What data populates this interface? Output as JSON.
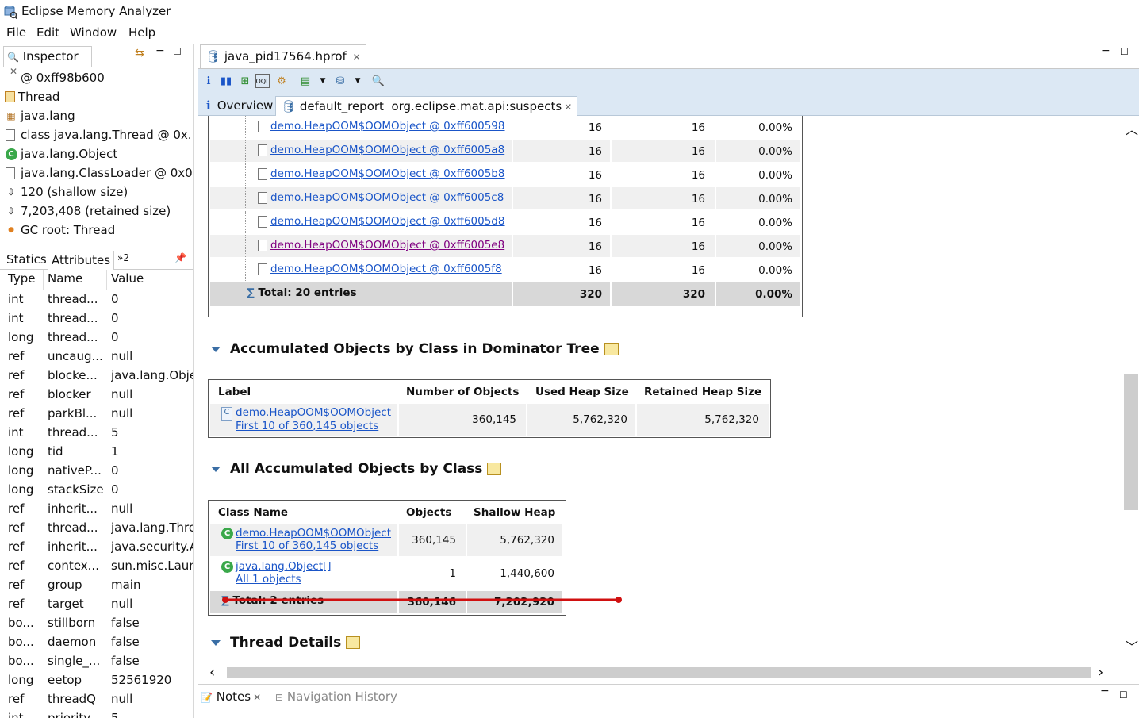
{
  "window": {
    "title": "Eclipse Memory Analyzer"
  },
  "menu": [
    "File",
    "Edit",
    "Window",
    "Help"
  ],
  "inspector": {
    "tab_label": "Inspector",
    "rows": [
      {
        "icon": "at-icon",
        "text": "@ 0xff98b600"
      },
      {
        "icon": "class-icon",
        "text": "Thread"
      },
      {
        "icon": "package-icon",
        "text": "java.lang"
      },
      {
        "icon": "class-file-icon",
        "text": "class java.lang.Thread @ 0x..."
      },
      {
        "icon": "class-green-icon",
        "text": "java.lang.Object"
      },
      {
        "icon": "class-file-icon",
        "text": "java.lang.ClassLoader @ 0x0"
      },
      {
        "icon": "size-icon",
        "text": "120 (shallow size)"
      },
      {
        "icon": "size-icon",
        "text": "7,203,408 (retained size)"
      },
      {
        "icon": "gc-root-icon",
        "text": "GC root: Thread"
      }
    ],
    "subtabs": [
      "Statics",
      "Attributes",
      "»2"
    ],
    "columns": [
      "Type",
      "Name",
      "Value"
    ],
    "attributes": [
      [
        "int",
        "thread...",
        "0"
      ],
      [
        "int",
        "thread...",
        "0"
      ],
      [
        "long",
        "thread...",
        "0"
      ],
      [
        "ref",
        "uncaug...",
        "null"
      ],
      [
        "ref",
        "blocke...",
        "java.lang.Obje"
      ],
      [
        "ref",
        "blocker",
        "null"
      ],
      [
        "ref",
        "parkBl...",
        "null"
      ],
      [
        "int",
        "thread...",
        "5"
      ],
      [
        "long",
        "tid",
        "1"
      ],
      [
        "long",
        "nativeP...",
        "0"
      ],
      [
        "long",
        "stackSize",
        "0"
      ],
      [
        "ref",
        "inherit...",
        "null"
      ],
      [
        "ref",
        "thread...",
        "java.lang.Thre"
      ],
      [
        "ref",
        "inherit...",
        "java.security.A"
      ],
      [
        "ref",
        "contex...",
        "sun.misc.Laun"
      ],
      [
        "ref",
        "group",
        "main"
      ],
      [
        "ref",
        "target",
        "null"
      ],
      [
        "bo...",
        "stillborn",
        "false"
      ],
      [
        "bo...",
        "daemon",
        "false"
      ],
      [
        "bo...",
        "single_...",
        "false"
      ],
      [
        "long",
        "eetop",
        "52561920"
      ],
      [
        "ref",
        "threadQ",
        "null"
      ],
      [
        "int",
        "priority",
        "5"
      ]
    ]
  },
  "editor": {
    "tab_label": "java_pid17564.hprof",
    "inner_tabs": [
      "Overview",
      "default_report  org.eclipse.mat.api:suspects"
    ],
    "top_table": {
      "rows": [
        [
          "demo.HeapOOM$OOMObject @ 0xff600598",
          "16",
          "16",
          "0.00%"
        ],
        [
          "demo.HeapOOM$OOMObject @ 0xff6005a8",
          "16",
          "16",
          "0.00%"
        ],
        [
          "demo.HeapOOM$OOMObject @ 0xff6005b8",
          "16",
          "16",
          "0.00%"
        ],
        [
          "demo.HeapOOM$OOMObject @ 0xff6005c8",
          "16",
          "16",
          "0.00%"
        ],
        [
          "demo.HeapOOM$OOMObject @ 0xff6005d8",
          "16",
          "16",
          "0.00%"
        ],
        [
          "demo.HeapOOM$OOMObject @ 0xff6005e8",
          "16",
          "16",
          "0.00%"
        ],
        [
          "demo.HeapOOM$OOMObject @ 0xff6005f8",
          "16",
          "16",
          "0.00%"
        ]
      ],
      "total": [
        "Total: 20 entries",
        "320",
        "320",
        "0.00%"
      ]
    },
    "section1": {
      "title": "Accumulated Objects by Class in Dominator Tree",
      "columns": [
        "Label",
        "Number of Objects",
        "Used Heap Size",
        "Retained Heap Size"
      ],
      "row": {
        "link1": "demo.HeapOOM$OOMObject",
        "link2": "First 10 of 360,145 objects",
        "objects": "360,145",
        "used": "5,762,320",
        "retained": "5,762,320"
      }
    },
    "section2": {
      "title": "All Accumulated Objects by Class",
      "columns": [
        "Class Name",
        "Objects",
        "Shallow Heap"
      ],
      "rows": [
        {
          "link1": "demo.HeapOOM$OOMObject",
          "link2": "First 10 of 360,145 objects",
          "objects": "360,145",
          "shallow": "5,762,320"
        },
        {
          "link1": "java.lang.Object[]",
          "link2": "All 1 objects",
          "objects": "1",
          "shallow": "1,440,600"
        }
      ],
      "total": [
        "Total: 2 entries",
        "360,146",
        "7,202,920"
      ]
    },
    "section3": {
      "title": "Thread Details"
    }
  },
  "bottom": {
    "tabs": [
      "Notes",
      "Navigation History"
    ]
  },
  "colors": {
    "link": "#1a55c8",
    "visited_link": "#800080",
    "annotation_line": "#d01010",
    "toolbar_bg": "#dce8f4"
  }
}
